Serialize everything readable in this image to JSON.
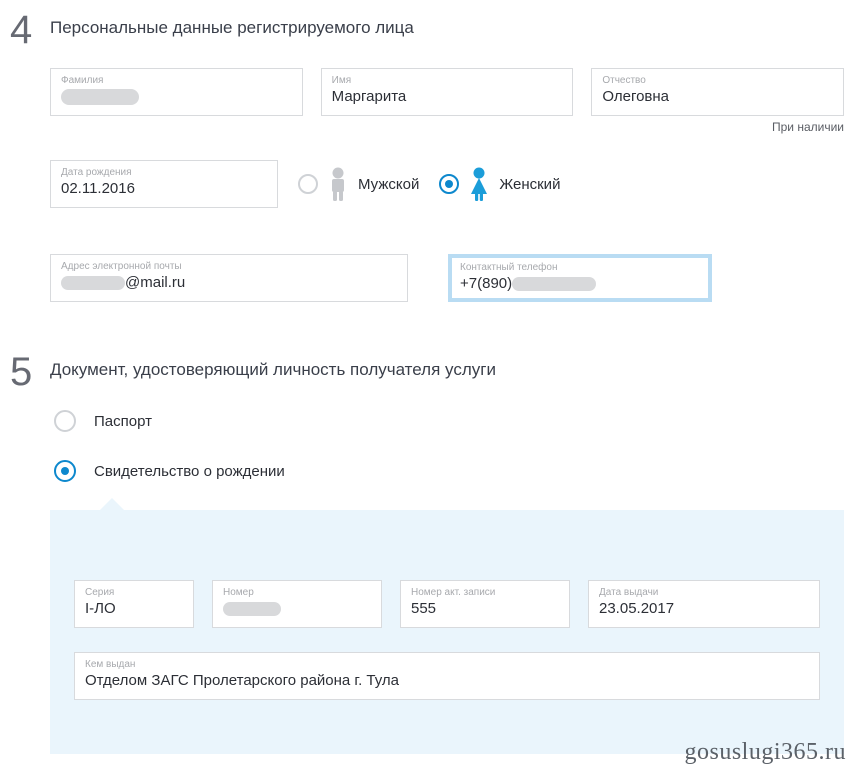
{
  "section4": {
    "num": "4",
    "title": "Персональные данные регистрируемого лица",
    "lastNameLabel": "Фамилия",
    "firstNameLabel": "Имя",
    "firstName": "Маргарита",
    "patronymLabel": "Отчество",
    "patronym": "Олеговна",
    "optionalNote": "При наличии",
    "dobLabel": "Дата рождения",
    "dob": "02.11.2016",
    "gender_male": "Мужской",
    "gender_female": "Женский",
    "emailLabel": "Адрес электронной почты",
    "emailSuffix": "@mail.ru",
    "phoneLabel": "Контактный телефон",
    "phonePrefix": "+7(890)"
  },
  "section5": {
    "num": "5",
    "title": "Документ, удостоверяющий личность получателя услуги",
    "opt_passport": "Паспорт",
    "opt_birthcert": "Свидетельство о рождении",
    "serLabel": "Серия",
    "ser": "I-ЛО",
    "numLabel": "Номер",
    "recLabel": "Номер акт. записи",
    "rec": "555",
    "issueDateLabel": "Дата выдачи",
    "issueDate": "23.05.2017",
    "issuedByLabel": "Кем выдан",
    "issuedBy": "Отделом ЗАГС Пролетарского района г. Тула"
  },
  "watermark": "gosuslugi365.ru"
}
